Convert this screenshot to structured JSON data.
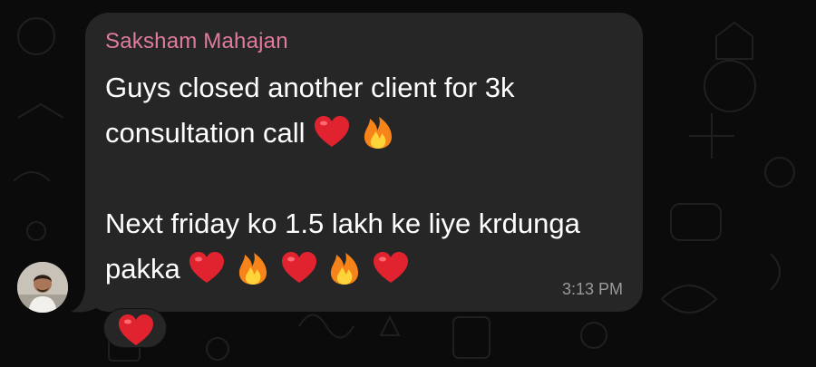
{
  "chat": {
    "message": {
      "sender": "Saksham Mahajan",
      "lines": [
        "Guys closed another client for 3k",
        "consultation call",
        "",
        "Next friday ko 1.5 lakh ke liye krdunga",
        "pakka"
      ],
      "emoji_after_line_2": [
        "heart",
        "fire"
      ],
      "emoji_after_line_5": [
        "heart",
        "fire",
        "heart",
        "fire",
        "heart"
      ],
      "time": "3:13 PM"
    },
    "reaction": {
      "emoji": "heart"
    }
  },
  "colors": {
    "background": "#0b0b0b",
    "bubble": "#262626",
    "sender_name": "#e17b9e",
    "message_text": "#ffffff",
    "timestamp": "#9a9a9a"
  }
}
